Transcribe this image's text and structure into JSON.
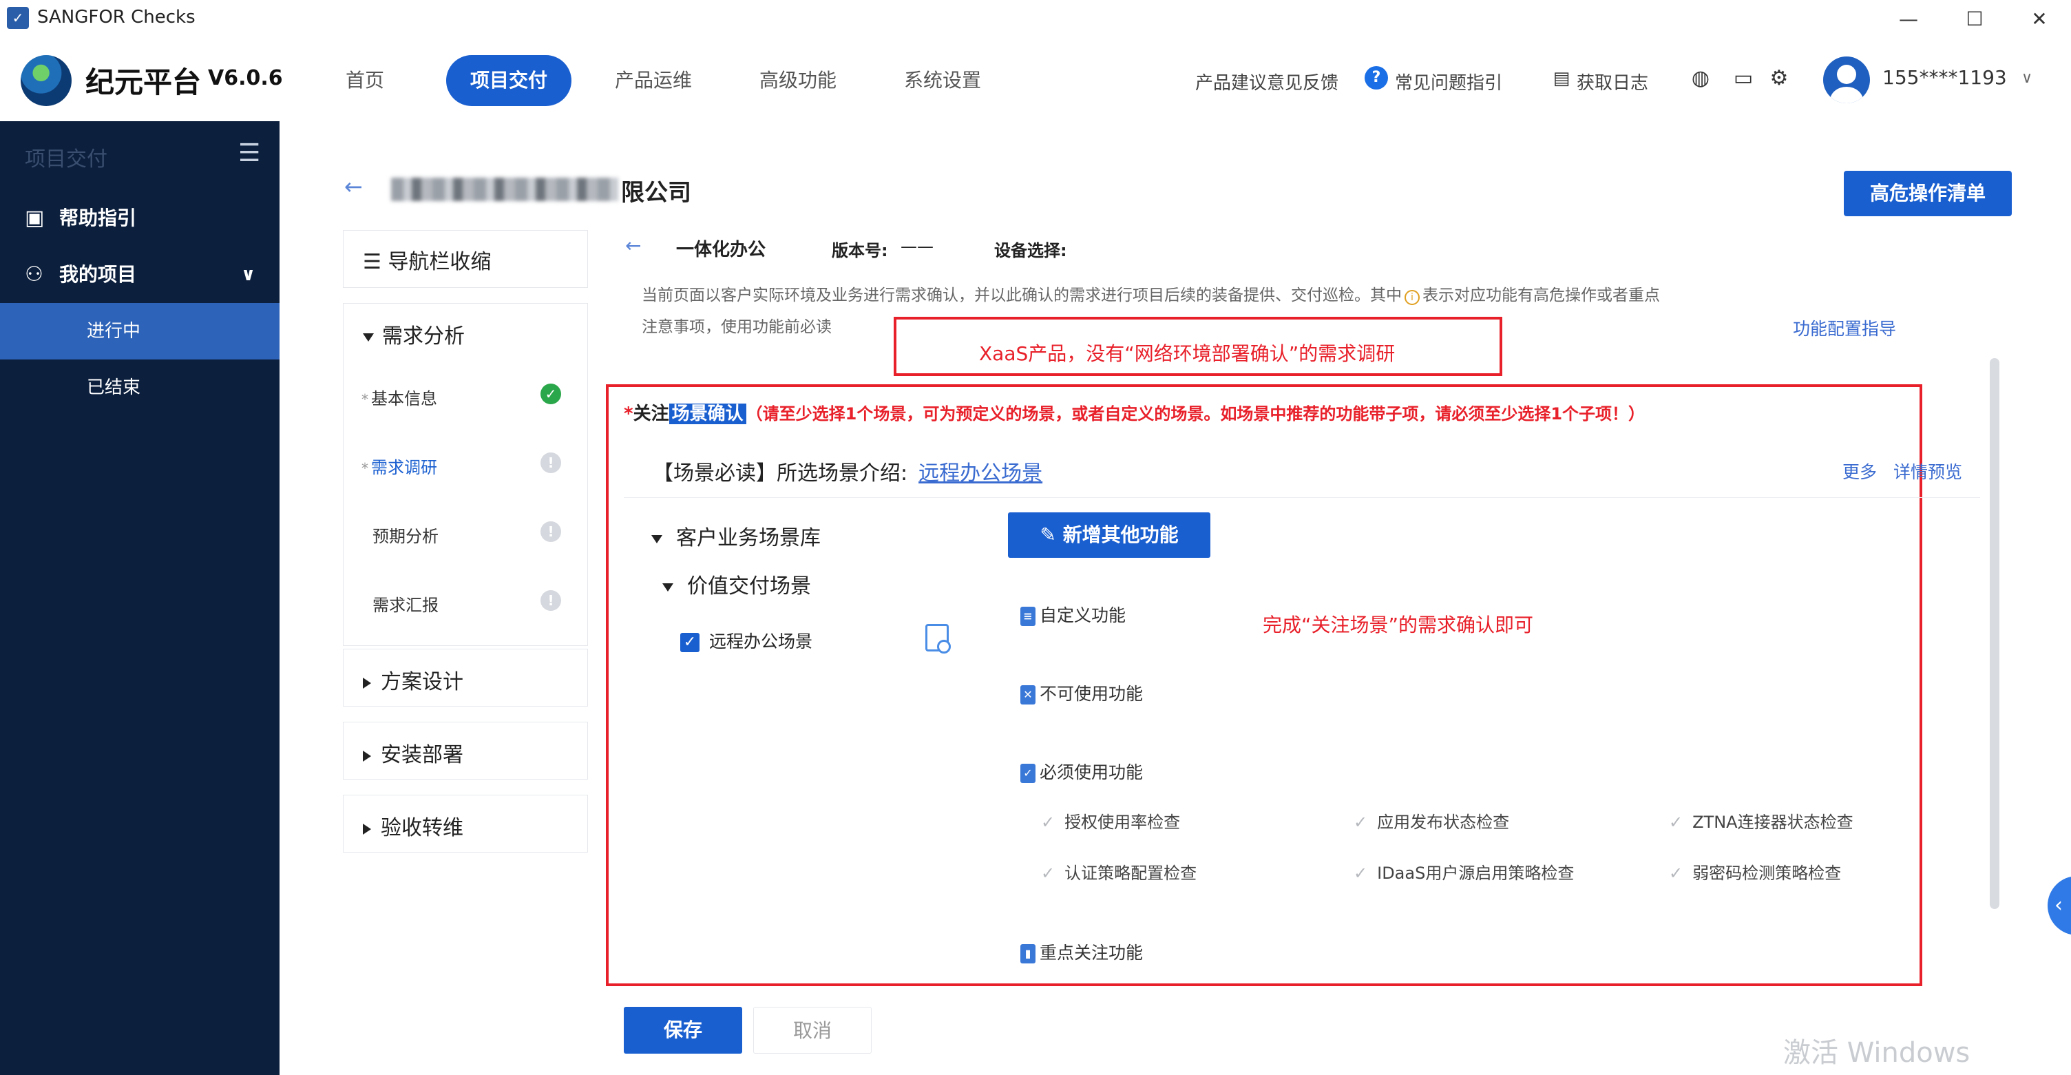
{
  "window": {
    "title": "SANGFOR Checks",
    "controls": {
      "minimize": "—",
      "maximize": "☐",
      "close": "✕"
    }
  },
  "header": {
    "brand_name": "纪元平台",
    "brand_version": "V6.0.6",
    "nav": [
      "首页",
      "项目交付",
      "产品运维",
      "高级功能",
      "系统设置"
    ],
    "active_nav": "项目交付",
    "feedback": "产品建议意见反馈",
    "faq": "常见问题指引",
    "logs": "获取日志",
    "user_phone": "155****1193"
  },
  "sidebar": {
    "title": "项目交付",
    "items": [
      {
        "label": "帮助指引"
      },
      {
        "label": "我的项目"
      }
    ],
    "sub_items": [
      {
        "label": "进行中"
      },
      {
        "label": "已结束"
      }
    ]
  },
  "page": {
    "company_suffix": "限公司",
    "danger_button": "高危操作清单"
  },
  "steps": {
    "collapse_label": "导航栏收缩",
    "group1": "需求分析",
    "group1_items": [
      "基本信息",
      "需求调研",
      "预期分析",
      "需求汇报"
    ],
    "group2": "方案设计",
    "group3": "安装部署",
    "group4": "验收转维"
  },
  "content": {
    "solution": "一体化办公",
    "version_label": "版本号:",
    "version_value": "——",
    "device_label": "设备选择:",
    "notice_line1a": "当前页面以客户实际环境及业务进行需求确认，并以此确认的需求进行项目后续的装备提供、交付巡检。其中",
    "notice_line1b": "表示对应功能有高危操作或者重点",
    "notice_line2": "注意事项，使用功能前必读",
    "config_guide": "功能配置指导",
    "annotation1": "XaaS产品，没有“网络环境部署确认”的需求调研",
    "annotation2": "完成“关注场景”的需求确认即可",
    "section_prefix": "关注",
    "section_highlight": "场景确认",
    "section_warning": "（请至少选择1个场景，可为预定义的场景，或者自定义的场景。如场景中推荐的功能带子项，请必须至少选择1个子项！）",
    "scene_intro": "【场景必读】所选场景介绍:",
    "scene_link": "远程办公场景",
    "more": "更多",
    "detail_preview": "详情预览",
    "tree_root": "客户业务场景库",
    "tree_child": "价值交付场景",
    "tree_leaf": "远程办公场景",
    "add_button": "新增其他功能",
    "custom_func": "自定义功能",
    "unusable_func": "不可使用功能",
    "required_func": "必须使用功能",
    "required_items": [
      "授权使用率检查",
      "应用发布状态检查",
      "ZTNA连接器状态检查",
      "认证策略配置检查",
      "IDaaS用户源启用策略检查",
      "弱密码检测策略检查"
    ],
    "focus_func": "重点关注功能"
  },
  "footer": {
    "save": "保存",
    "cancel": "取消",
    "watermark": "激活 Windows"
  }
}
